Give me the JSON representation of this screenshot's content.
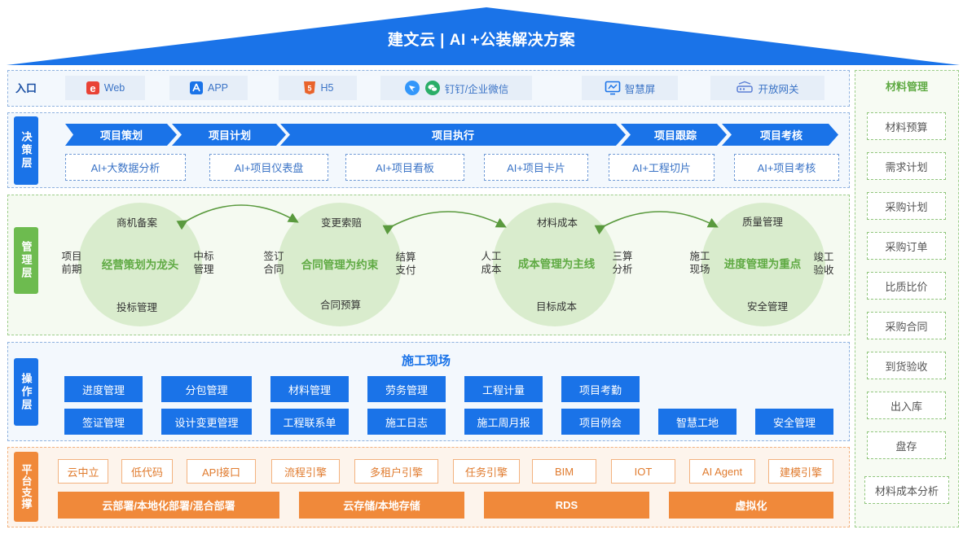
{
  "title": "建文云 | AI +公装解决方案",
  "entry": {
    "label": "入口",
    "items": [
      {
        "label": "Web",
        "icon": "web-e-icon"
      },
      {
        "label": "APP",
        "icon": "app-store-icon"
      },
      {
        "label": "H5",
        "icon": "html5-icon"
      },
      {
        "label": "钉钉/企业微信",
        "icon": "dingtalk-wechat-icon"
      },
      {
        "label": "智慧屏",
        "icon": "smart-screen-icon"
      },
      {
        "label": "开放网关",
        "icon": "gateway-icon"
      }
    ]
  },
  "decision": {
    "label": "决策层",
    "phases": [
      "项目策划",
      "项目计划",
      "项目执行",
      "项目跟踪",
      "项目考核"
    ],
    "tools": [
      "AI+大数据分析",
      "AI+项目仪表盘",
      "AI+项目看板",
      "AI+项目卡片",
      "AI+工程切片",
      "AI+项目考核"
    ]
  },
  "management": {
    "label": "管理层",
    "circles": [
      {
        "title": "经营策划为龙头",
        "top": "商机备案",
        "bottom": "投标管理",
        "left": "项目\n前期",
        "right": "中标\n管理"
      },
      {
        "title": "合同管理为约束",
        "top": "变更索赔",
        "bottom": "合同预算",
        "left": "签订\n合同",
        "right": "结算\n支付"
      },
      {
        "title": "成本管理为主线",
        "top": "材料成本",
        "bottom": "目标成本",
        "left": "人工\n成本",
        "right": "三算\n分析"
      },
      {
        "title": "进度管理为重点",
        "top": "质量管理",
        "bottom": "安全管理",
        "left": "施工\n现场",
        "right": "竣工\n验收"
      }
    ]
  },
  "operation": {
    "label": "操作层",
    "title": "施工现场",
    "row1": [
      "进度管理",
      "分包管理",
      "材料管理",
      "劳务管理",
      "工程计量",
      "项目考勤"
    ],
    "row2": [
      "签证管理",
      "设计变更管理",
      "工程联系单",
      "施工日志",
      "施工周月报",
      "项目例会",
      "智慧工地",
      "安全管理"
    ]
  },
  "platform": {
    "label": "平台支撑",
    "services": [
      "云中立",
      "低代码",
      "API接口",
      "流程引擎",
      "多租户引擎",
      "任务引擎",
      "BIM",
      "IOT",
      "AI Agent",
      "建模引擎"
    ],
    "infra": [
      "云部署/本地化部署/混合部署",
      "云存储/本地存储",
      "RDS",
      "虚拟化"
    ]
  },
  "side": {
    "title": "材料管理",
    "items": [
      "材料预算",
      "需求计划",
      "采购计划",
      "采购订单",
      "比质比价",
      "采购合同",
      "到货验收",
      "出入库",
      "盘存",
      "材料成本分析"
    ]
  },
  "colors": {
    "primary": "#1a73e8",
    "green": "#6dbb4f",
    "orange": "#f0893a",
    "roof": "#1a73e8"
  }
}
